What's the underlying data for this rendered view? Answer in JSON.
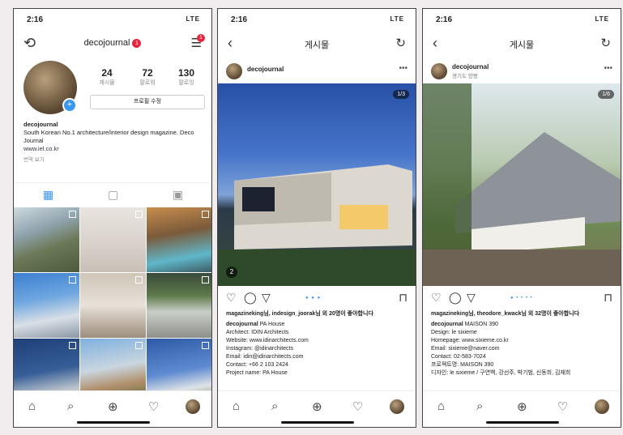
{
  "status_time": "2:16",
  "status_signal": "LTE",
  "profile": {
    "username": "decojournal",
    "notif_count": "1",
    "stats": [
      {
        "n": "24",
        "l": "게시물"
      },
      {
        "n": "72",
        "l": "팔로워"
      },
      {
        "n": "130",
        "l": "팔로잉"
      }
    ],
    "edit_label": "프로필 수정",
    "bio_name": "decojournal",
    "bio_text": "South Korean No.1 architecture/interior design magazine. Deco Journal",
    "bio_link": "www.iel.co.kr",
    "bio_more": "번역 보기"
  },
  "post1": {
    "title": "게시물",
    "username": "decojournal",
    "counter": "1/3",
    "tag": "2",
    "likes": "magazineking님, indesign_joorak님 외 20명이 좋아합니다",
    "caption_user": "decojournal",
    "caption_title": "PA House",
    "lines": [
      "Architect: IDIN Architects",
      "Website: www.idinarchitects.com",
      "Instagram: @idinarchitects",
      "Email: idin@idinarchitects.com",
      "Contact: +66 2 103 2424",
      "Project name: PA House"
    ]
  },
  "post2": {
    "title": "게시물",
    "username": "decojournal",
    "location": "경기도 양평",
    "counter": "1/6",
    "likes": "magazineking님, theodore_kwack님 외 32명이 좋아합니다",
    "caption_user": "decojournal",
    "caption_title": "MAISON 390",
    "lines": [
      "Design: le sixieme",
      "Homepage: www.sixieme.co.kr",
      "Email: sixieme@naver.com",
      "Contact: 02-583-7024",
      "프로젝트명: MAISON 390",
      "디자인: le sixieme / 구연백, 강선주, 박기범, 신동희, 김재희"
    ]
  },
  "icons": {
    "back": "‹",
    "refresh": "↻",
    "home": "⌂",
    "search": "⌕",
    "add": "⊕",
    "heart": "♡",
    "comment": "◯",
    "share": "▽",
    "bookmark": "⊓"
  }
}
